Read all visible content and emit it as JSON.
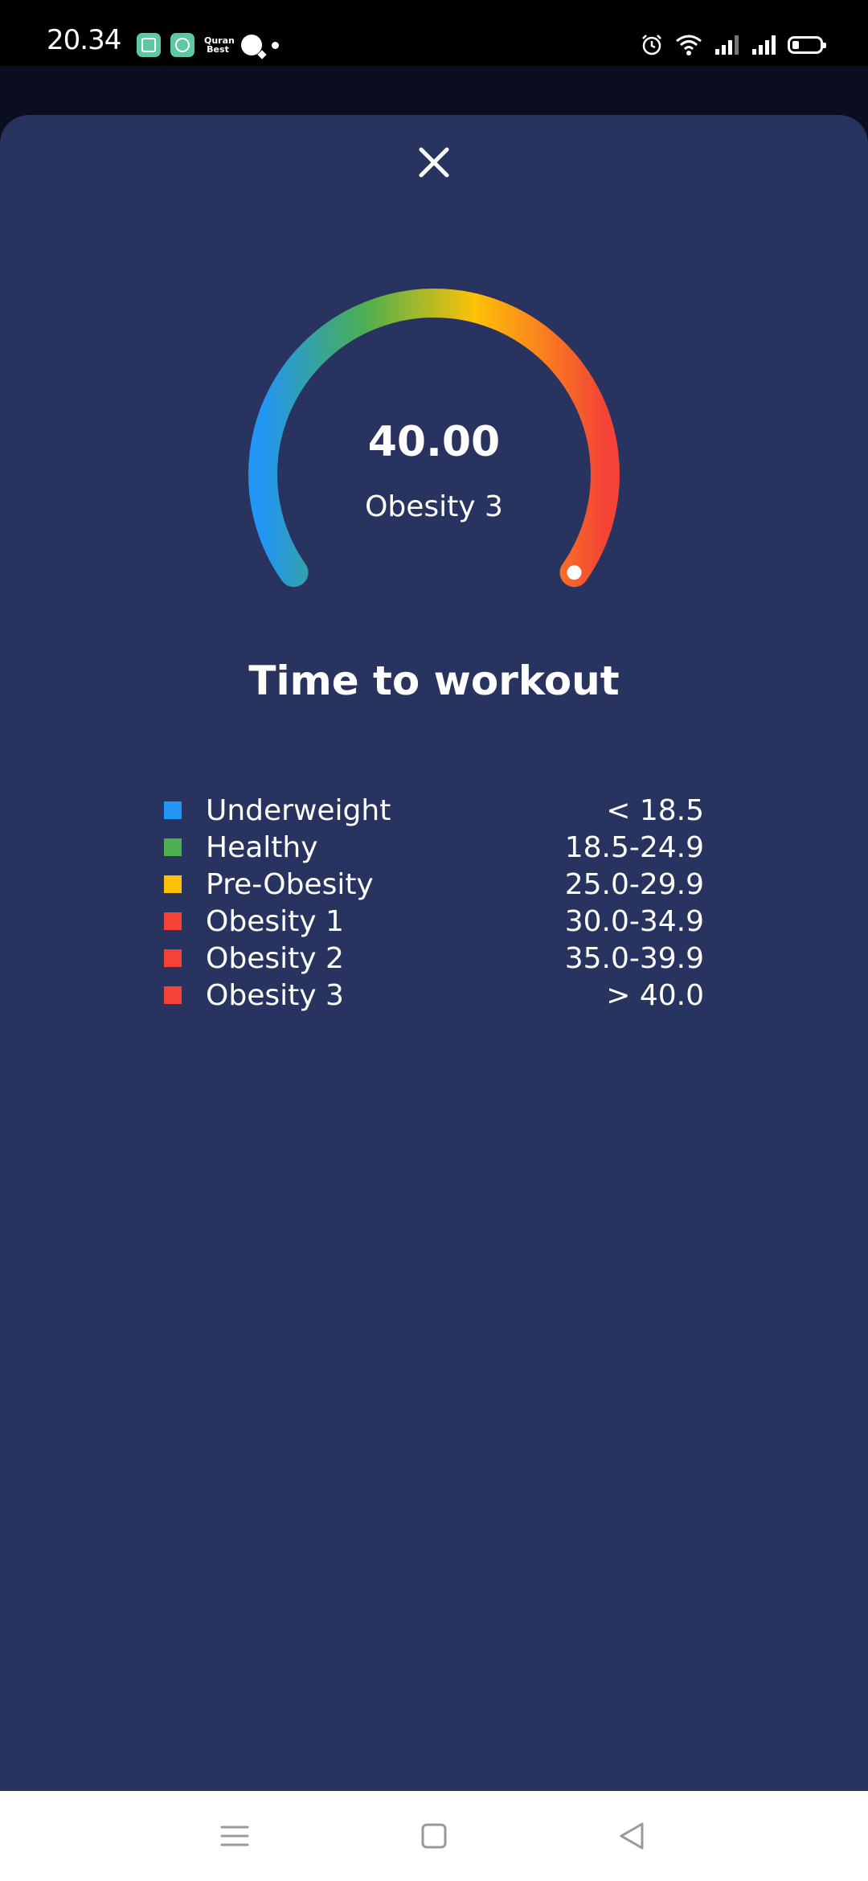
{
  "status_bar": {
    "time": "20.34",
    "quran_line1": "Quran",
    "quran_line2": "Best"
  },
  "gauge": {
    "value": "40.00",
    "category": "Obesity 3",
    "indicator_fraction": 1.0,
    "colors": [
      "#2196F3",
      "#4CAF50",
      "#FFC107",
      "#F44336"
    ]
  },
  "headline": "Time to workout",
  "legend": [
    {
      "label": "Underweight",
      "range": "< 18.5",
      "color": "#2196F3"
    },
    {
      "label": "Healthy",
      "range": "18.5-24.9",
      "color": "#4CAF50"
    },
    {
      "label": "Pre-Obesity",
      "range": "25.0-29.9",
      "color": "#FFC107"
    },
    {
      "label": "Obesity 1",
      "range": "30.0-34.9",
      "color": "#F44336"
    },
    {
      "label": "Obesity 2",
      "range": "35.0-39.9",
      "color": "#F44336"
    },
    {
      "label": "Obesity 3",
      "range": "> 40.0",
      "color": "#F44336"
    }
  ],
  "icons": {
    "close": "close-icon",
    "menu": "menu-icon",
    "home": "home-icon",
    "back": "back-icon"
  }
}
